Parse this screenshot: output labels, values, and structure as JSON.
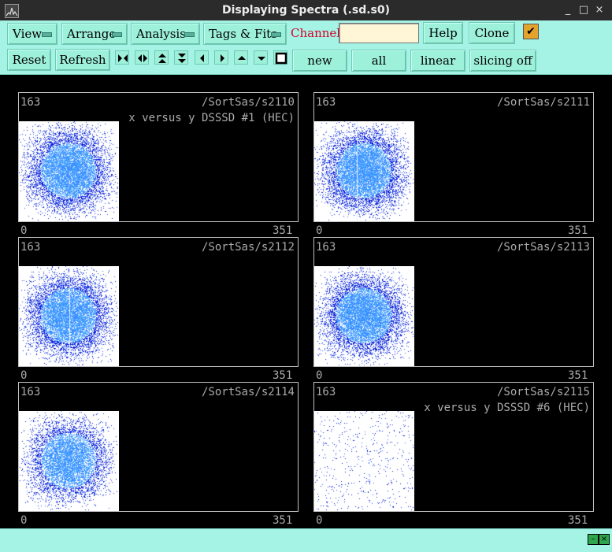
{
  "window": {
    "title": "Displaying Spectra (.sd.s0)",
    "controls": [
      "_",
      "□",
      "×"
    ]
  },
  "toolbar": {
    "menus": [
      "View",
      "Arrange",
      "Analysis",
      "Tags & Fits"
    ],
    "channel_label": "Channel:",
    "channel_value": "",
    "help": "Help",
    "clone": "Clone",
    "checked_mark": "✔",
    "reset": "Reset",
    "refresh": "Refresh",
    "mode_buttons": [
      "new",
      "all",
      "linear",
      "slicing off"
    ]
  },
  "panels": [
    {
      "ycount": "163",
      "path": "/SortSas/s2110",
      "desc": "x versus y DSSSD #1 (HEC)",
      "xmin": "0",
      "xmax": "351",
      "style": "dense-sparse"
    },
    {
      "ycount": "163",
      "path": "/SortSas/s2111",
      "desc": "",
      "xmin": "0",
      "xmax": "351",
      "style": "dense-line"
    },
    {
      "ycount": "163",
      "path": "/SortSas/s2112",
      "desc": "",
      "xmin": "0",
      "xmax": "351",
      "style": "dense-line"
    },
    {
      "ycount": "163",
      "path": "/SortSas/s2113",
      "desc": "",
      "xmin": "0",
      "xmax": "351",
      "style": "dense"
    },
    {
      "ycount": "163",
      "path": "/SortSas/s2114",
      "desc": "",
      "xmin": "0",
      "xmax": "351",
      "style": "medium"
    },
    {
      "ycount": "163",
      "path": "/SortSas/s2115",
      "desc": "x versus y DSSSD #6 (HEC)",
      "xmin": "0",
      "xmax": "351",
      "style": "sparse"
    }
  ],
  "colors": {
    "toolbar_bg": "#a5f3e4",
    "button_bg": "#9df0da",
    "channel_label": "#d8002a",
    "plot_blue_dark": "#0a1fd6",
    "plot_blue_light": "#5ab2ff"
  }
}
